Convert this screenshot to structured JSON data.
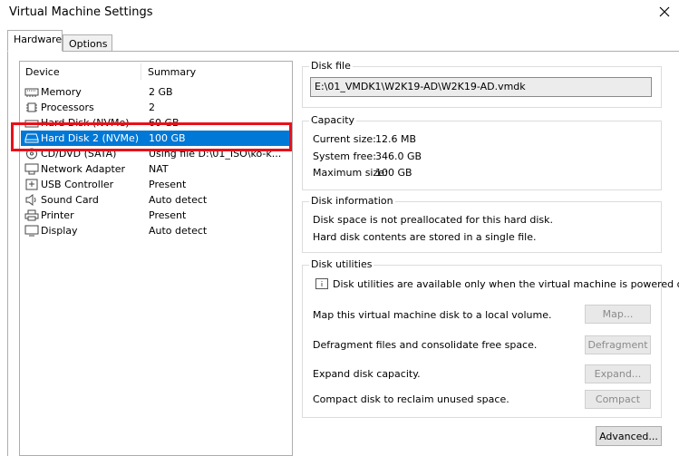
{
  "window": {
    "title": "Virtual Machine Settings"
  },
  "tabs": [
    {
      "label": "Hardware",
      "active": true
    },
    {
      "label": "Options",
      "active": false
    }
  ],
  "device_list": {
    "headers": {
      "device": "Device",
      "summary": "Summary"
    },
    "rows": [
      {
        "name": "Memory",
        "summary": "2 GB",
        "icon": "memory-icon"
      },
      {
        "name": "Processors",
        "summary": "2",
        "icon": "processor-icon"
      },
      {
        "name": "Hard Disk (NVMe)",
        "summary": "60 GB",
        "icon": "hard-disk-icon"
      },
      {
        "name": "Hard Disk 2 (NVMe)",
        "summary": "100 GB",
        "icon": "hard-disk-icon",
        "selected": true
      },
      {
        "name": "CD/DVD (SATA)",
        "summary": "Using file D:\\01_ISO\\ko-k...",
        "icon": "cd-dvd-icon"
      },
      {
        "name": "Network Adapter",
        "summary": "NAT",
        "icon": "network-adapter-icon"
      },
      {
        "name": "USB Controller",
        "summary": "Present",
        "icon": "usb-icon"
      },
      {
        "name": "Sound Card",
        "summary": "Auto detect",
        "icon": "speaker-icon"
      },
      {
        "name": "Printer",
        "summary": "Present",
        "icon": "printer-icon"
      },
      {
        "name": "Display",
        "summary": "Auto detect",
        "icon": "display-icon"
      }
    ]
  },
  "disk_file": {
    "title": "Disk file",
    "path": "E:\\01_VMDK1\\W2K19-AD\\W2K19-AD.vmdk"
  },
  "capacity": {
    "title": "Capacity",
    "current_label": "Current size:",
    "current_value": "12.6 MB",
    "free_label": "System free:",
    "free_value": "346.0 GB",
    "max_label": "Maximum size:",
    "max_value": "100 GB"
  },
  "disk_info": {
    "title": "Disk information",
    "line1": "Disk space is not preallocated for this hard disk.",
    "line2": "Hard disk contents are stored in a single file."
  },
  "disk_utilities": {
    "title": "Disk utilities",
    "notice": "Disk utilities are available only when the virtual machine is powered off.",
    "map_text": "Map this virtual machine disk to a local volume.",
    "map_button": "Map...",
    "defrag_text": "Defragment files and consolidate free space.",
    "defrag_button": "Defragment",
    "expand_text": "Expand disk capacity.",
    "expand_button": "Expand...",
    "compact_text": "Compact disk to reclaim unused space.",
    "compact_button": "Compact"
  },
  "advanced_button": "Advanced..."
}
